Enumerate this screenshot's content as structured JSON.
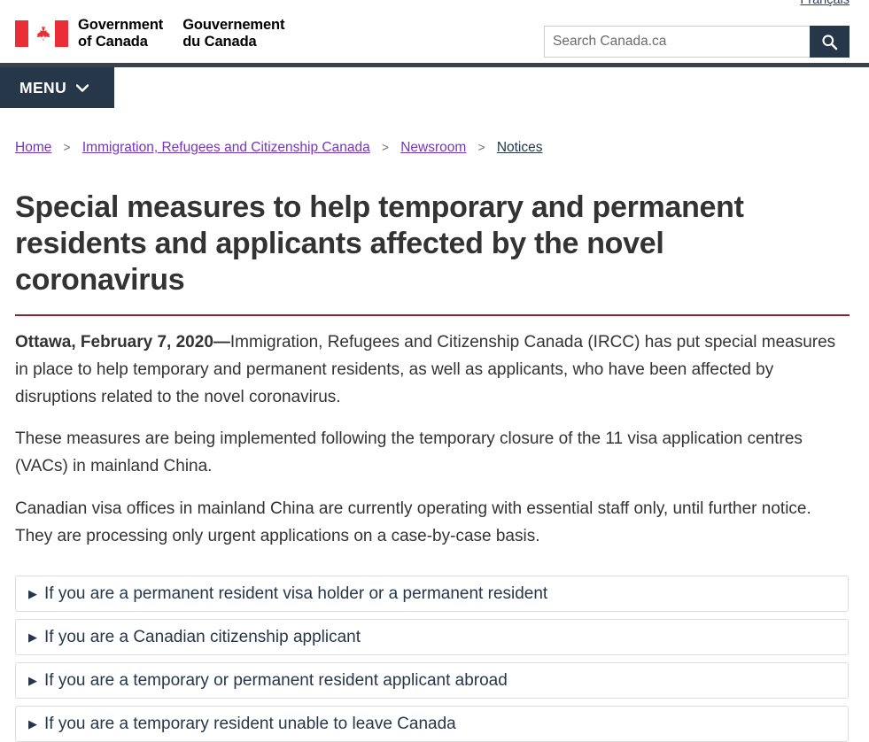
{
  "header": {
    "lang_toggle": "Français",
    "wordmark_en_line1": "Government",
    "wordmark_en_line2": "of Canada",
    "wordmark_fr_line1": "Gouvernement",
    "wordmark_fr_line2": "du Canada",
    "flag_icon": "canada-flag-icon",
    "search": {
      "placeholder": "Search Canada.ca",
      "value": "",
      "button_icon": "search-icon"
    },
    "menu": {
      "label": "MENU",
      "caret_icon": "chevron-down-icon"
    }
  },
  "breadcrumb": {
    "separator": ">",
    "items": [
      {
        "label": "Home",
        "current": false
      },
      {
        "label": "Immigration, Refugees and Citizenship Canada",
        "current": false
      },
      {
        "label": "Newsroom",
        "current": false
      },
      {
        "label": "Notices",
        "current": true
      }
    ]
  },
  "main": {
    "title": "Special measures to help temporary and permanent residents and applicants affected by the novel coronavirus",
    "paragraphs": [
      {
        "dateline": "Ottawa, February 7, 2020—",
        "text": "Immigration, Refugees and Citizenship Canada (IRCC) has put special measures in place to help temporary and permanent residents, as well as applicants, who have been affected by disruptions related to the novel coronavirus."
      },
      {
        "dateline": "",
        "text": "These measures are being implemented following the temporary closure of the 11 visa application centres (VACs) in mainland China."
      },
      {
        "dateline": "",
        "text": "Canadian visa offices in mainland China are currently operating with essential staff only, until further notice. They are processing only urgent applications on a case-by-case basis."
      }
    ],
    "accordions": [
      {
        "marker": "collapsed-triangle-icon",
        "label": "If you are a permanent resident visa holder or a permanent resident",
        "expanded": false
      },
      {
        "marker": "collapsed-triangle-icon",
        "label": "If you are a Canadian citizenship applicant",
        "expanded": false
      },
      {
        "marker": "collapsed-triangle-icon",
        "label": "If you are a temporary or permanent resident applicant abroad",
        "expanded": false
      },
      {
        "marker": "collapsed-triangle-icon",
        "label": "If you are a temporary resident unable to leave Canada",
        "expanded": false
      }
    ]
  },
  "colors": {
    "brand_navy": "#26374a",
    "menu_rule": "#38414d",
    "title_rule_red": "#8b2331",
    "flag_red": "#ea2d37",
    "link_visited_purple": "#7834bc",
    "accordion_border": "#dddddd",
    "body_text": "#333333"
  }
}
